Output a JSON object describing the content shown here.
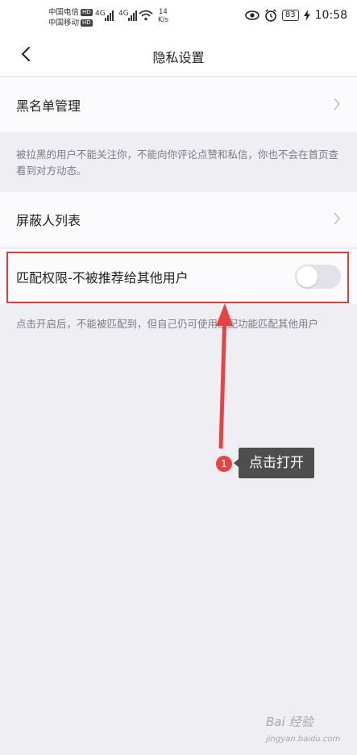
{
  "status_bar": {
    "carrier1": "中国电信",
    "carrier2": "中国移动",
    "hd": "HD",
    "net1": "4G",
    "net2": "4G",
    "speed_value": "14",
    "speed_unit": "K/s",
    "battery": "83",
    "time": "10:58"
  },
  "nav": {
    "title": "隐私设置"
  },
  "settings": {
    "blacklist_label": "黑名单管理",
    "blacklist_note": "被拉黑的用户不能关注你，不能向你评论点赞和私信，你也不会在首页查看到对方动态。",
    "blocked_list_label": "屏蔽人列表",
    "match_label": "匹配权限-不被推荐给其他用户",
    "match_toggle_on": false,
    "match_note": "点击开启后，不能被匹配到，但自己仍可使用匹配功能匹配其他用户"
  },
  "annotation": {
    "step_number": "1",
    "tooltip": "点击打开"
  },
  "watermark": {
    "text": "Bai",
    "text2": "经验",
    "sub": "jingyan.baidu.com"
  },
  "colors": {
    "highlight_border": "#e23b3b",
    "arrow": "#e84343",
    "tooltip_bg": "#4e4e4e",
    "background": "#eeeef3"
  }
}
